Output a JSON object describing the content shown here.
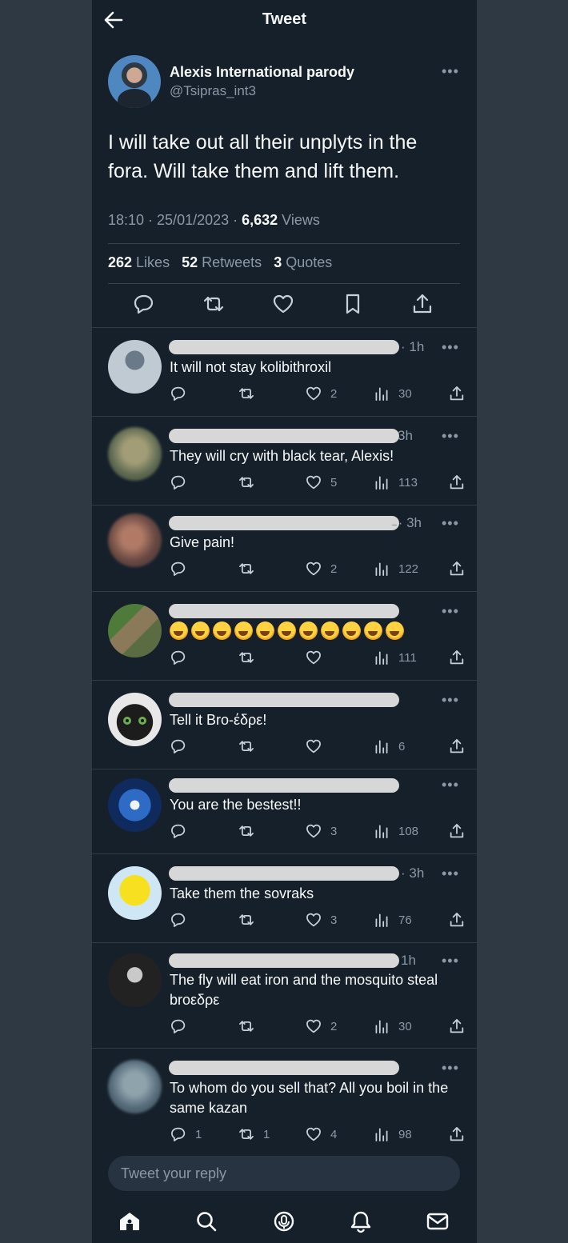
{
  "header": {
    "title": "Tweet",
    "back_icon": "arrow-left-icon"
  },
  "tweet": {
    "author_name": "Alexis International parody",
    "author_handle": "@Tsipras_int3",
    "text": "I will take out all their unplyts in the fora. Will take them and lift them.",
    "time": "18:10 · 25/01/2023 · ",
    "views_count": "6,632",
    "views_label": " Views",
    "likes_count": "262",
    "likes_label": " Likes",
    "retweets_count": "52",
    "retweets_label": " Retweets",
    "quotes_count": "3",
    "quotes_label": " Quotes"
  },
  "replies": [
    {
      "time": "· 1h",
      "text": "It will not stay kolibithroxil",
      "replies": "",
      "retweets": "",
      "likes": "2",
      "views": "30"
    },
    {
      "time": "3h",
      "text": "They will cry with black tear, Alexis!",
      "replies": "",
      "retweets": "",
      "likes": "5",
      "views": "113"
    },
    {
      "time": "̵ · 3h",
      "text": "Give pain!",
      "replies": "",
      "retweets": "",
      "likes": "2",
      "views": "122"
    },
    {
      "time": "",
      "text": "🤣🤣🤣🤣🤣🤣🤣🤣🤣🤣🤣",
      "replies": "",
      "retweets": "",
      "likes": "",
      "views": "111"
    },
    {
      "time": "",
      "text": "Tell it Bro-έδρε!",
      "replies": "",
      "retweets": "",
      "likes": "",
      "views": "6"
    },
    {
      "time": "",
      "text": "You are the bestest!!",
      "replies": "",
      "retweets": "",
      "likes": "3",
      "views": "108"
    },
    {
      "time": "· 3h",
      "text": "Take them the sovraks",
      "replies": "",
      "retweets": "",
      "likes": "3",
      "views": "76"
    },
    {
      "time": "1h",
      "text": "The fly will eat iron and the mosquito steal broεδρε",
      "replies": "",
      "retweets": "",
      "likes": "2",
      "views": "30"
    },
    {
      "time": "",
      "text": "To whom do you sell that?  All you boil in the same kazan",
      "replies": "1",
      "retweets": "1",
      "likes": "4",
      "views": "98"
    }
  ],
  "compose": {
    "placeholder": "Tweet your reply"
  },
  "navbar": {
    "items": [
      "home-icon",
      "search-icon",
      "spaces-icon",
      "notifications-icon",
      "messages-icon"
    ]
  },
  "colors": {
    "background": "#16202b",
    "text": "#f7f9f9",
    "muted": "#8b98a5",
    "divider": "#38444d"
  }
}
